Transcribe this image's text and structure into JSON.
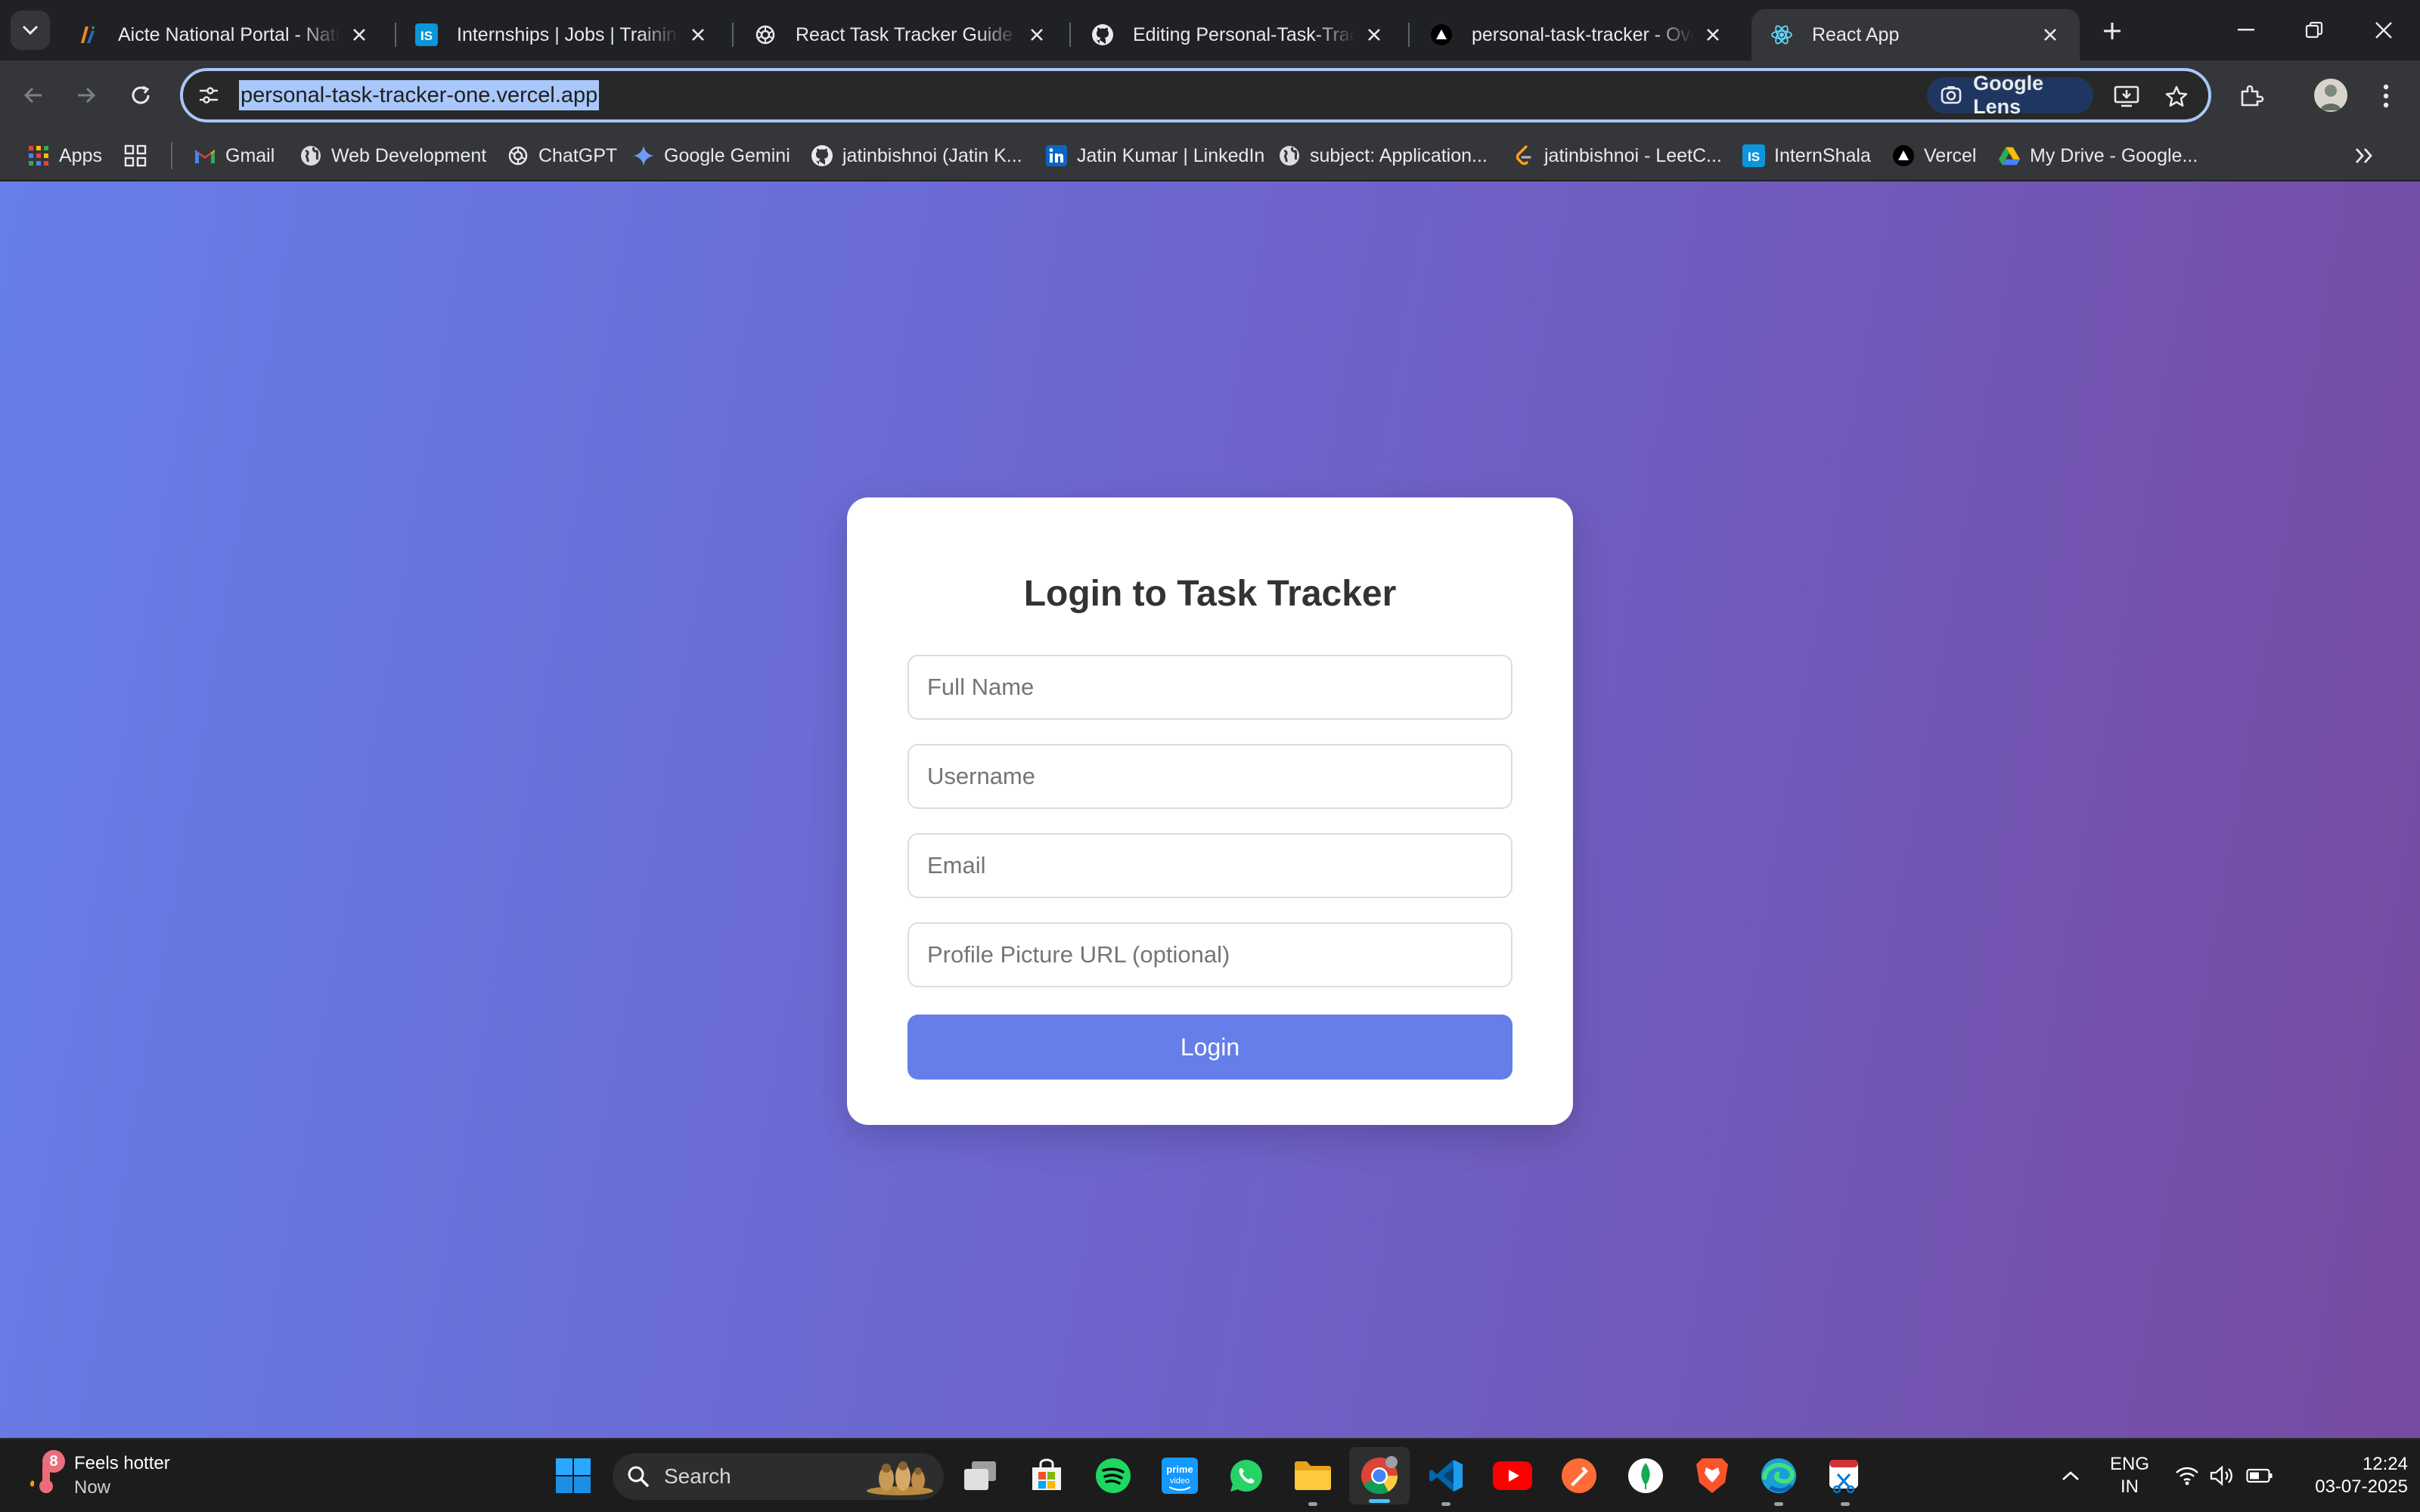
{
  "browser": {
    "tabs": [
      {
        "title": "Aicte National Portal - National Internship Portal",
        "favicon": "aicte-icon",
        "active": false
      },
      {
        "title": "Internships | Jobs | Trainings | Internshala",
        "favicon": "internshala-icon",
        "active": false
      },
      {
        "title": "React Task Tracker Guide",
        "favicon": "chatgpt-icon",
        "active": false
      },
      {
        "title": "Editing Personal-Task-Tracker",
        "favicon": "github-icon",
        "active": false
      },
      {
        "title": "personal-task-tracker - Overview",
        "favicon": "vercel-icon",
        "active": false
      },
      {
        "title": "React App",
        "favicon": "react-icon",
        "active": true
      }
    ],
    "address_bar": {
      "url": "personal-task-tracker-one.vercel.app",
      "lens_label": "Google Lens"
    },
    "bookmarks": [
      {
        "label": "Apps",
        "icon": "apps-grid-icon"
      },
      {
        "label": "",
        "icon": "app-launcher-icon"
      },
      {
        "label": "Gmail",
        "icon": "gmail-icon"
      },
      {
        "label": "Web Development",
        "icon": "globe-icon"
      },
      {
        "label": "ChatGPT",
        "icon": "chatgpt-icon"
      },
      {
        "label": "Google Gemini",
        "icon": "gemini-icon"
      },
      {
        "label": "jatinbishnoi (Jatin K...",
        "icon": "github-icon"
      },
      {
        "label": "Jatin Kumar | LinkedIn",
        "icon": "linkedin-icon"
      },
      {
        "label": "subject: Application...",
        "icon": "globe-icon"
      },
      {
        "label": "jatinbishnoi - LeetC...",
        "icon": "leetcode-icon"
      },
      {
        "label": "InternShala",
        "icon": "internshala-icon"
      },
      {
        "label": "Vercel",
        "icon": "vercel-icon"
      },
      {
        "label": "My Drive - Google...",
        "icon": "google-drive-icon"
      }
    ]
  },
  "page": {
    "title": "Login to Task Tracker",
    "fields": {
      "full_name": {
        "placeholder": "Full Name",
        "value": ""
      },
      "username": {
        "placeholder": "Username",
        "value": ""
      },
      "email": {
        "placeholder": "Email",
        "value": ""
      },
      "profile_picture": {
        "placeholder": "Profile Picture URL (optional)",
        "value": ""
      }
    },
    "login_button": "Login"
  },
  "taskbar": {
    "weather": {
      "title": "Feels hotter",
      "subtitle": "Now",
      "badge": "8"
    },
    "search_label": "Search",
    "language": {
      "line1": "ENG",
      "line2": "IN"
    },
    "clock": {
      "time": "12:24",
      "date": "03-07-2025"
    }
  },
  "colors": {
    "gradient_start": "#667eea",
    "gradient_end": "#764ba2",
    "button": "#667eea",
    "url_highlight": "#a8c7fa"
  }
}
